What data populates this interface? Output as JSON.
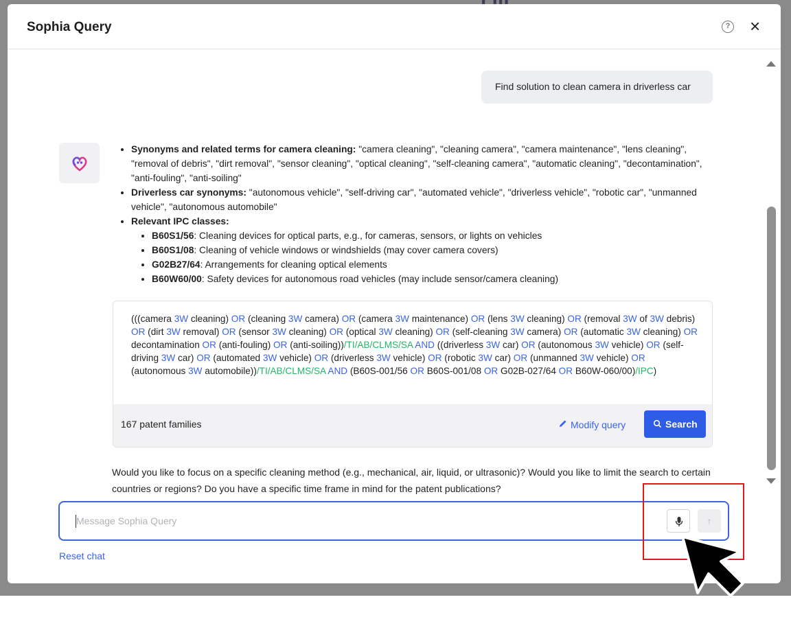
{
  "window": {
    "title": "Sophia Query",
    "help_icon": "?",
    "close_icon": "×"
  },
  "chat": {
    "user_message": "Find solution to clean camera in driverless car",
    "bot": {
      "avatar_icon": "sophia-logo",
      "bullets": [
        {
          "bold": "Synonyms and related terms for camera cleaning:",
          "text": " \"camera cleaning\", \"cleaning camera\", \"camera maintenance\", \"lens cleaning\", \"removal of debris\", \"dirt removal\", \"sensor cleaning\", \"optical cleaning\", \"self-cleaning camera\", \"automatic cleaning\", \"decontamination\", \"anti-fouling\", \"anti-soiling\""
        },
        {
          "bold": "Driverless car synonyms:",
          "text": " \"autonomous vehicle\", \"self-driving car\", \"automated vehicle\", \"driverless vehicle\", \"robotic car\", \"unmanned vehicle\", \"autonomous automobile\""
        },
        {
          "bold": "Relevant IPC classes:",
          "text": ""
        }
      ],
      "ipc": [
        {
          "code": "B60S1/56",
          "desc": ": Cleaning devices for optical parts, e.g., for cameras, sensors, or lights on vehicles"
        },
        {
          "code": "B60S1/08",
          "desc": ": Cleaning of vehicle windows or windshields (may cover camera covers)"
        },
        {
          "code": "G02B27/64",
          "desc": ": Arrangements for cleaning optical elements"
        },
        {
          "code": "B60W60/00",
          "desc": ": Safety devices for autonomous road vehicles (may include sensor/camera cleaning)"
        }
      ]
    },
    "query": {
      "tokens": [
        [
          "(((camera ",
          "t"
        ],
        [
          "3W",
          "k"
        ],
        [
          " cleaning) ",
          "t"
        ],
        [
          "OR",
          "k"
        ],
        [
          " (cleaning ",
          "t"
        ],
        [
          "3W",
          "k"
        ],
        [
          " camera) ",
          "t"
        ],
        [
          "OR",
          "k"
        ],
        [
          " (camera ",
          "t"
        ],
        [
          "3W",
          "k"
        ],
        [
          " maintenance) ",
          "t"
        ],
        [
          "OR",
          "k"
        ],
        [
          " (lens ",
          "t"
        ],
        [
          "3W",
          "k"
        ],
        [
          " cleaning) ",
          "t"
        ],
        [
          "OR",
          "k"
        ],
        [
          " (removal ",
          "t"
        ],
        [
          "3W",
          "k"
        ],
        [
          " of ",
          "t"
        ],
        [
          "3W",
          "k"
        ],
        [
          " debris) ",
          "t"
        ],
        [
          "OR",
          "k"
        ],
        [
          " (dirt ",
          "t"
        ],
        [
          "3W",
          "k"
        ],
        [
          " removal) ",
          "t"
        ],
        [
          "OR",
          "k"
        ],
        [
          " (sensor ",
          "t"
        ],
        [
          "3W",
          "k"
        ],
        [
          " cleaning) ",
          "t"
        ],
        [
          "OR",
          "k"
        ],
        [
          " (optical ",
          "t"
        ],
        [
          "3W",
          "k"
        ],
        [
          " cleaning) ",
          "t"
        ],
        [
          "OR",
          "k"
        ],
        [
          " (self-cleaning ",
          "t"
        ],
        [
          "3W",
          "k"
        ],
        [
          " camera) ",
          "t"
        ],
        [
          "OR",
          "k"
        ],
        [
          " (automatic ",
          "t"
        ],
        [
          "3W",
          "k"
        ],
        [
          " cleaning) ",
          "t"
        ],
        [
          "OR",
          "k"
        ],
        [
          " decontamination ",
          "t"
        ],
        [
          "OR",
          "k"
        ],
        [
          " (anti-fouling) ",
          "t"
        ],
        [
          "OR",
          "k"
        ],
        [
          " (anti-soiling))",
          "t"
        ],
        [
          "/TI/AB/CLMS/SA",
          "f"
        ],
        [
          " ",
          "t"
        ],
        [
          "AND",
          "k"
        ],
        [
          " ((driverless ",
          "t"
        ],
        [
          "3W",
          "k"
        ],
        [
          " car) ",
          "t"
        ],
        [
          "OR",
          "k"
        ],
        [
          " (autonomous ",
          "t"
        ],
        [
          "3W",
          "k"
        ],
        [
          " vehicle) ",
          "t"
        ],
        [
          "OR",
          "k"
        ],
        [
          " (self-driving ",
          "t"
        ],
        [
          "3W",
          "k"
        ],
        [
          " car) ",
          "t"
        ],
        [
          "OR",
          "k"
        ],
        [
          " (automated ",
          "t"
        ],
        [
          "3W",
          "k"
        ],
        [
          " vehicle) ",
          "t"
        ],
        [
          "OR",
          "k"
        ],
        [
          " (driverless ",
          "t"
        ],
        [
          "3W",
          "k"
        ],
        [
          " vehicle) ",
          "t"
        ],
        [
          "OR",
          "k"
        ],
        [
          " (robotic ",
          "t"
        ],
        [
          "3W",
          "k"
        ],
        [
          " car) ",
          "t"
        ],
        [
          "OR",
          "k"
        ],
        [
          " (unmanned ",
          "t"
        ],
        [
          "3W",
          "k"
        ],
        [
          " vehicle) ",
          "t"
        ],
        [
          "OR",
          "k"
        ],
        [
          " (autonomous ",
          "t"
        ],
        [
          "3W",
          "k"
        ],
        [
          " automobile))",
          "t"
        ],
        [
          "/TI/AB/CLMS/SA",
          "f"
        ],
        [
          " ",
          "t"
        ],
        [
          "AND",
          "k"
        ],
        [
          " (B60S-001/56 ",
          "t"
        ],
        [
          "OR",
          "k"
        ],
        [
          " B60S-001/08 ",
          "t"
        ],
        [
          "OR",
          "k"
        ],
        [
          " G02B-027/64 ",
          "t"
        ],
        [
          "OR",
          "k"
        ],
        [
          " B60W-060/00)",
          "t"
        ],
        [
          "/IPC",
          "f"
        ],
        [
          ")",
          "t"
        ]
      ],
      "families": "167 patent families",
      "modify_label": "Modify query",
      "search_label": "Search"
    },
    "followup": "Would you like to focus on a specific cleaning method (e.g., mechanical, air, liquid, or ultrasonic)? Would you like to limit the search to certain countries or regions? Do you have a specific time frame in mind for the patent publications?"
  },
  "composer": {
    "placeholder": "Message Sophia Query",
    "value": "",
    "mic_icon": "microphone-icon",
    "send_icon": "↑"
  },
  "reset_label": "Reset chat",
  "colors": {
    "accent": "#2f5ce6",
    "keyword": "#3a64e6",
    "field": "#22b866",
    "highlight": "#e01b1b"
  }
}
